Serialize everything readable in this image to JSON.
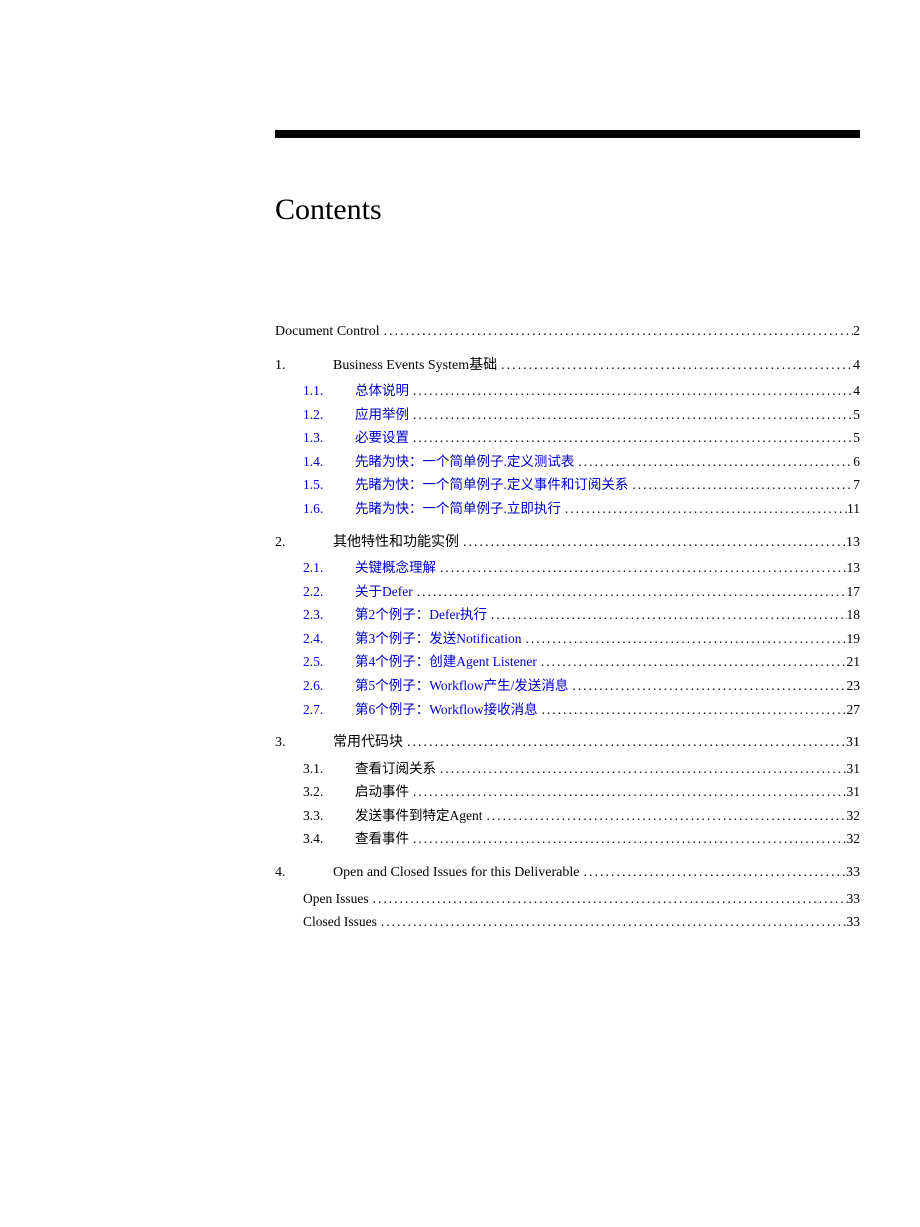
{
  "title": "Contents",
  "lines": [
    {
      "type": "top",
      "num": "",
      "label": "Document Control",
      "page": "2",
      "spaced": false
    },
    {
      "type": "top",
      "num": "1.",
      "label": "Business Events System基础",
      "page": "4",
      "spaced": true
    },
    {
      "type": "group-start"
    },
    {
      "type": "sub",
      "num": "1.1.",
      "label": "总体说明",
      "page": "4",
      "link": true
    },
    {
      "type": "sub",
      "num": "1.2.",
      "label": "应用举例",
      "page": "5",
      "link": true
    },
    {
      "type": "sub",
      "num": "1.3.",
      "label": "必要设置",
      "page": "5",
      "link": true
    },
    {
      "type": "sub",
      "num": "1.4.",
      "label": "先睹为快：一个简单例子.定义测试表",
      "page": "6",
      "link": true
    },
    {
      "type": "sub",
      "num": "1.5.",
      "label": "先睹为快：一个简单例子.定义事件和订阅关系",
      "page": "7",
      "link": true
    },
    {
      "type": "sub",
      "num": "1.6.",
      "label": "先睹为快：一个简单例子.立即执行",
      "page": "11",
      "link": true
    },
    {
      "type": "group-end"
    },
    {
      "type": "top",
      "num": "2.",
      "label": "其他特性和功能实例",
      "page": "13",
      "spaced": true
    },
    {
      "type": "group-start"
    },
    {
      "type": "sub",
      "num": "2.1.",
      "label": "关键概念理解",
      "page": "13",
      "link": true
    },
    {
      "type": "sub",
      "num": "2.2.",
      "label": "关于Defer",
      "page": "17",
      "link": true
    },
    {
      "type": "sub",
      "num": "2.3.",
      "label": "第2个例子：Defer执行",
      "page": "18",
      "link": true
    },
    {
      "type": "sub",
      "num": "2.4.",
      "label": "第3个例子：发送Notification",
      "page": "19",
      "link": true
    },
    {
      "type": "sub",
      "num": "2.5.",
      "label": "第4个例子：创建Agent Listener",
      "page": "21",
      "link": true
    },
    {
      "type": "sub",
      "num": "2.6.",
      "label": "第5个例子：Workflow产生/发送消息",
      "page": "23",
      "link": true
    },
    {
      "type": "sub",
      "num": "2.7.",
      "label": "第6个例子：Workflow接收消息",
      "page": "27",
      "link": true
    },
    {
      "type": "group-end"
    },
    {
      "type": "top",
      "num": "3.",
      "label": "常用代码块",
      "page": "31",
      "spaced": true
    },
    {
      "type": "group-start"
    },
    {
      "type": "sub",
      "num": "3.1.",
      "label": "查看订阅关系",
      "page": "31",
      "link": false
    },
    {
      "type": "sub",
      "num": "3.2.",
      "label": "启动事件",
      "page": "31",
      "link": false
    },
    {
      "type": "sub",
      "num": "3.3.",
      "label": "发送事件到特定Agent",
      "page": "32",
      "link": false
    },
    {
      "type": "sub",
      "num": "3.4.",
      "label": "查看事件",
      "page": "32",
      "link": false
    },
    {
      "type": "group-end"
    },
    {
      "type": "top",
      "num": "4.",
      "label": "Open and Closed Issues for this Deliverable",
      "page": "33",
      "spaced": true
    },
    {
      "type": "group-start"
    },
    {
      "type": "indent1",
      "label": "Open Issues",
      "page": "33"
    },
    {
      "type": "indent1",
      "label": "Closed Issues",
      "page": "33"
    },
    {
      "type": "group-end"
    }
  ]
}
